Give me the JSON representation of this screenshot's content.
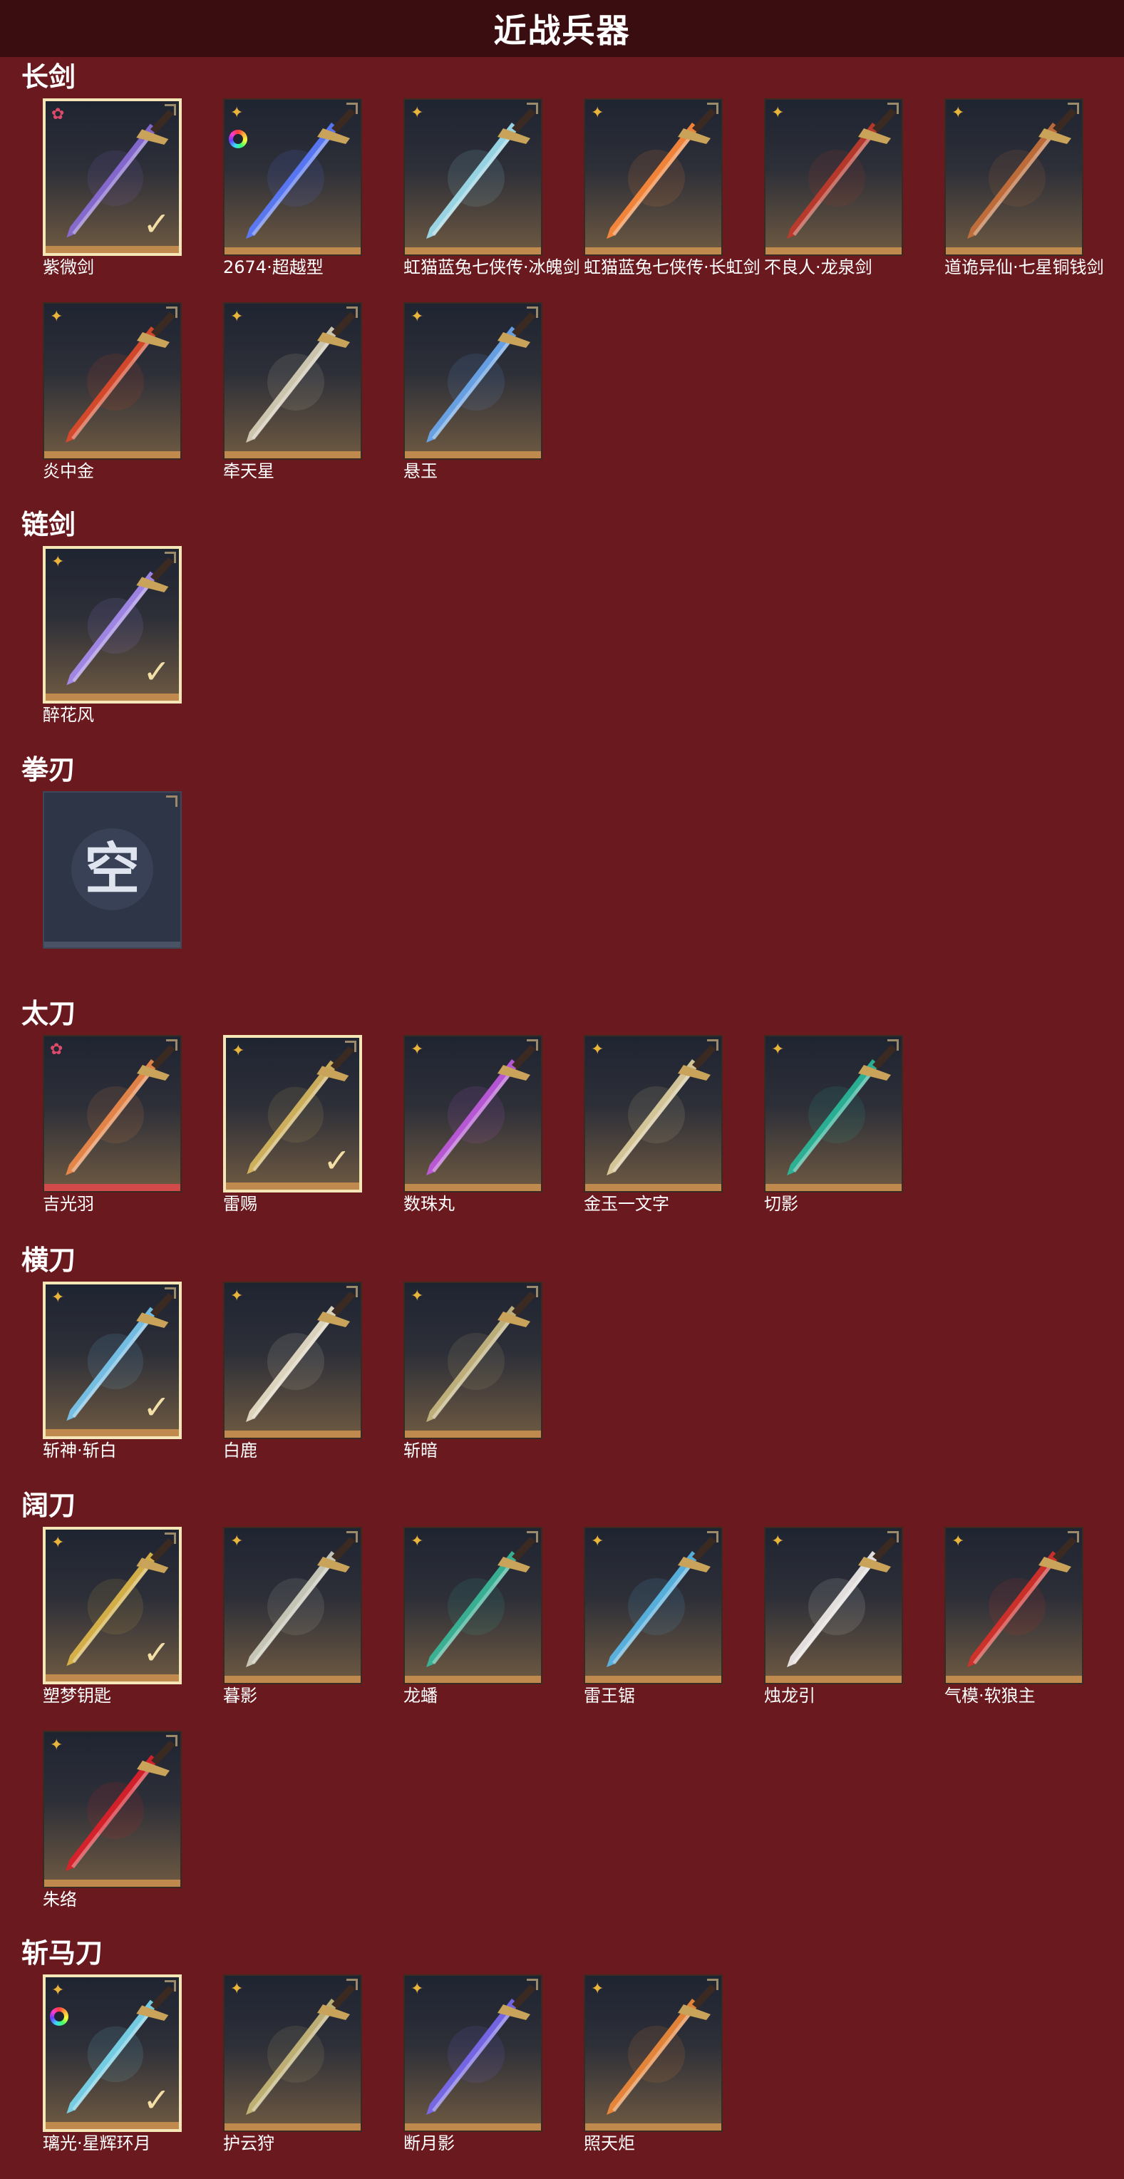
{
  "header": {
    "title": "近战兵器"
  },
  "sections": [
    {
      "title": "长剑",
      "items": [
        {
          "name": "紫微剑",
          "rarity": "pink",
          "selected": true,
          "rainbow": false,
          "color": "#8a6cd8"
        },
        {
          "name": "2674·超越型",
          "rarity": "gold",
          "selected": false,
          "rainbow": true,
          "color": "#5b7cff"
        },
        {
          "name": "虹猫蓝兔七侠传·冰魄剑",
          "rarity": "gold",
          "selected": false,
          "rainbow": false,
          "color": "#9fe0f0"
        },
        {
          "name": "虹猫蓝兔七侠传·长虹剑",
          "rarity": "gold",
          "selected": false,
          "rainbow": false,
          "color": "#ff8a3b"
        },
        {
          "name": "不良人·龙泉剑",
          "rarity": "gold",
          "selected": false,
          "rainbow": false,
          "color": "#c0392b"
        },
        {
          "name": "道诡异仙·七星铜钱剑",
          "rarity": "gold",
          "selected": false,
          "rainbow": false,
          "color": "#c8703a"
        },
        {
          "name": "炎中金",
          "rarity": "gold",
          "selected": false,
          "rainbow": false,
          "color": "#e04a2a"
        },
        {
          "name": "牵天星",
          "rarity": "gold",
          "selected": false,
          "rainbow": false,
          "color": "#d8d0b8"
        },
        {
          "name": "悬玉",
          "rarity": "gold",
          "selected": false,
          "rainbow": false,
          "color": "#6aa8f0"
        }
      ]
    },
    {
      "title": "链剑",
      "items": [
        {
          "name": "醉花风",
          "rarity": "gold",
          "selected": true,
          "rainbow": false,
          "color": "#a78bf0"
        }
      ]
    },
    {
      "title": "拳刃",
      "items": [
        {
          "name": "",
          "rarity": "",
          "selected": false,
          "rainbow": false,
          "empty": true,
          "empty_text": "空",
          "color": "#dfe4ee"
        }
      ]
    },
    {
      "title": "太刀",
      "items": [
        {
          "name": "吉光羽",
          "rarity": "pink",
          "selected": false,
          "rainbow": false,
          "color": "#f08a4a",
          "red": true
        },
        {
          "name": "雷赐",
          "rarity": "gold",
          "selected": true,
          "rainbow": false,
          "color": "#d8b860"
        },
        {
          "name": "数珠丸",
          "rarity": "gold",
          "selected": false,
          "rainbow": false,
          "color": "#c05ae0"
        },
        {
          "name": "金玉一文字",
          "rarity": "gold",
          "selected": false,
          "rainbow": false,
          "color": "#e0d0a0"
        },
        {
          "name": "切影",
          "rarity": "gold",
          "selected": false,
          "rainbow": false,
          "color": "#2ab89a"
        }
      ]
    },
    {
      "title": "横刀",
      "items": [
        {
          "name": "斩神·斩白",
          "rarity": "gold",
          "selected": true,
          "rainbow": false,
          "color": "#7ac8f0"
        },
        {
          "name": "白鹿",
          "rarity": "gold",
          "selected": false,
          "rainbow": false,
          "color": "#e8e0c8"
        },
        {
          "name": "斩暗",
          "rarity": "gold",
          "selected": false,
          "rainbow": false,
          "color": "#c8b880"
        }
      ]
    },
    {
      "title": "阔刀",
      "items": [
        {
          "name": "塑梦钥匙",
          "rarity": "gold",
          "selected": true,
          "rainbow": false,
          "color": "#e0b84a"
        },
        {
          "name": "暮影",
          "rarity": "gold",
          "selected": false,
          "rainbow": false,
          "color": "#d0d0c0"
        },
        {
          "name": "龙蟠",
          "rarity": "gold",
          "selected": false,
          "rainbow": false,
          "color": "#3ab89a"
        },
        {
          "name": "雷王锯",
          "rarity": "gold",
          "selected": false,
          "rainbow": false,
          "color": "#5ab8e8"
        },
        {
          "name": "烛龙引",
          "rarity": "gold",
          "selected": false,
          "rainbow": false,
          "color": "#f0ecea"
        },
        {
          "name": "气模·软狼主",
          "rarity": "gold",
          "selected": false,
          "rainbow": false,
          "color": "#d8302a"
        },
        {
          "name": "朱络",
          "rarity": "gold",
          "selected": false,
          "rainbow": false,
          "color": "#e0202a"
        }
      ]
    },
    {
      "title": "斩马刀",
      "items": [
        {
          "name": "璃光·星辉环月",
          "rarity": "gold",
          "selected": true,
          "rainbow": true,
          "color": "#7ad8f0"
        },
        {
          "name": "护云狩",
          "rarity": "gold",
          "selected": false,
          "rainbow": false,
          "color": "#c8b878"
        },
        {
          "name": "断月影",
          "rarity": "gold",
          "selected": false,
          "rainbow": false,
          "color": "#7a6af0"
        },
        {
          "name": "照天炬",
          "rarity": "gold",
          "selected": false,
          "rainbow": false,
          "color": "#f08a3a"
        }
      ]
    }
  ]
}
